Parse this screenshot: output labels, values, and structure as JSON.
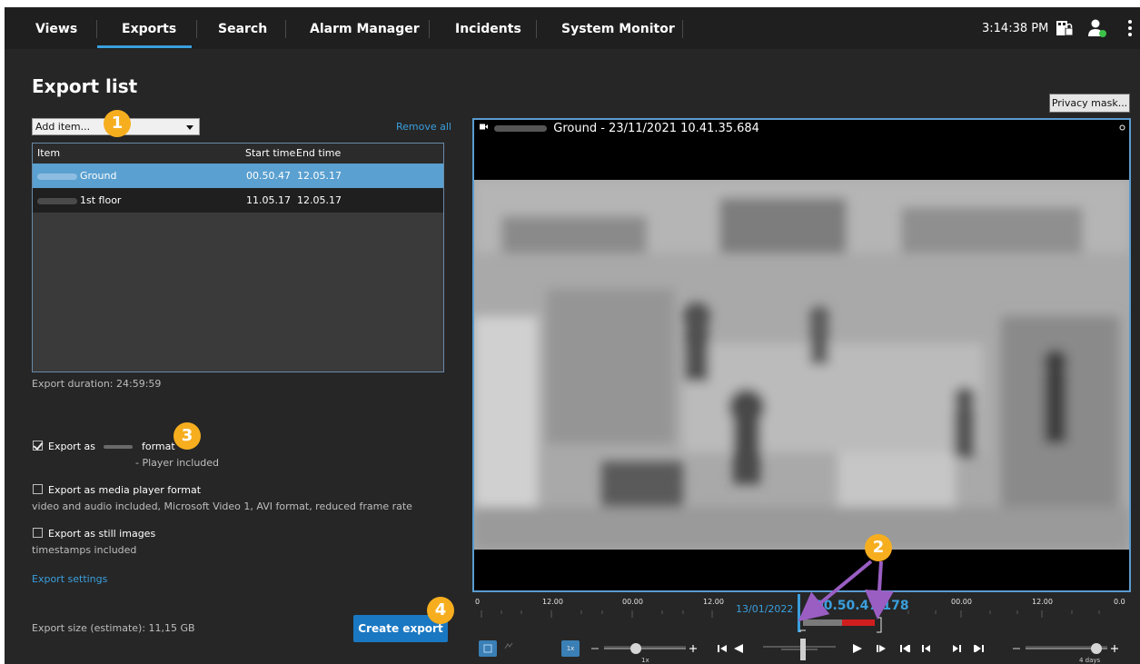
{
  "nav": {
    "tabs": [
      {
        "label": "Views"
      },
      {
        "label": "Exports"
      },
      {
        "label": "Search"
      },
      {
        "label": "Alarm Manager"
      },
      {
        "label": "Incidents"
      },
      {
        "label": "System Monitor"
      }
    ],
    "active_tab": "Exports",
    "clock": "3:14:38 PM"
  },
  "page": {
    "title": "Export list"
  },
  "toolbar": {
    "add_item": "Add item...",
    "remove_all": "Remove all"
  },
  "table": {
    "columns": [
      "Item",
      "Start time",
      "End time"
    ],
    "rows": [
      {
        "name": "Ground",
        "start": "00.50.47",
        "end": "12.05.17",
        "selected": true
      },
      {
        "name": "1st floor",
        "start": "11.05.17",
        "end": "12.05.17",
        "selected": false
      }
    ]
  },
  "export": {
    "duration": "Export duration:  24:59:59",
    "format_prefix": "Export as",
    "format_suffix": "format",
    "format_note": "- Player included",
    "media_player": "Export as media player format",
    "media_player_note": "video and audio included, Microsoft Video 1, AVI format, reduced frame rate",
    "still_images": "Export as still images",
    "still_images_note": "timestamps included",
    "settings_link": "Export settings",
    "size": "Export size (estimate): 11,15 GB",
    "create_button": "Create export"
  },
  "video": {
    "privacy_mask": "Privacy mask...",
    "title": "Ground - 23/11/2021 10.41.35.684"
  },
  "timeline": {
    "ticks": [
      "0",
      "12.00",
      "00.00",
      "12.00",
      "00.00",
      "12.00",
      "0.0"
    ],
    "date": "13/01/2022",
    "time": "00.50.47.178",
    "speed": "1x",
    "speed_button": "1x",
    "span": "4 days"
  },
  "callouts": [
    "1",
    "2",
    "3",
    "4"
  ],
  "colors": {
    "accent": "#3a9fdd",
    "badge": "#f6ae1f",
    "selection": "#5aa0d0",
    "export_range": "#d01e1e"
  },
  "icons": [
    "camera-icon",
    "user-status-icon",
    "more-vertical-icon",
    "skip-back-icon",
    "play-icon",
    "skip-forward-icon",
    "zoom-icon"
  ]
}
